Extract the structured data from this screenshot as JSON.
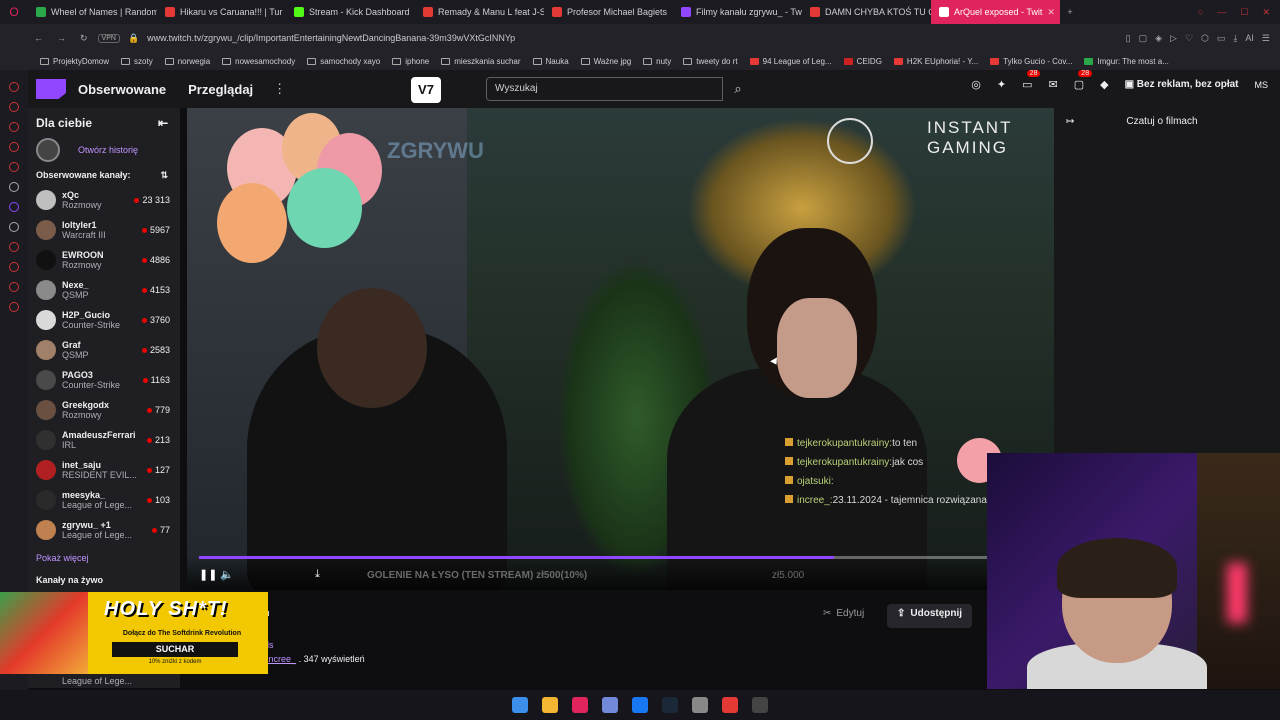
{
  "browser": {
    "tabs": [
      {
        "label": "Wheel of Names | Random",
        "color": "#2aa84a"
      },
      {
        "label": "Hikaru vs Caruana!!! | Tur",
        "color": "#e53935"
      },
      {
        "label": "Stream - Kick Dashboard",
        "color": "#53fc18"
      },
      {
        "label": "Remady & Manu L feat J-S",
        "color": "#e53935"
      },
      {
        "label": "Profesor Michael Bagiets",
        "color": "#e53935"
      },
      {
        "label": "Filmy kanału zgrywu_ - Tw",
        "color": "#9147ff"
      },
      {
        "label": "DAMN CHYBA KTOŚ TU C",
        "color": "#e53935"
      },
      {
        "label": "ArQuel exposed - Twit",
        "color": "#9147ff",
        "active": true
      }
    ],
    "url": "www.twitch.tv/zgrywu_/clip/ImportantEntertainingNewtDancingBanana-39m39wVXtGcINNYp",
    "vpn_label": "VPN",
    "ai_label": "AI",
    "bookmarks": [
      "ProjektyDomow",
      "szoty",
      "norwegia",
      "nowesamochody",
      "samochody xayo",
      "iphone",
      "mieszkania suchar",
      "Nauka",
      "Ważne jpg",
      "nuty",
      "tweety do rt",
      "94 League of Leg...",
      "CEIDG",
      "H2K EUphoria! - Y...",
      "Tylko Gucio - Cov...",
      "Imgur: The most a..."
    ]
  },
  "twitch": {
    "nav_following": "Obserwowane",
    "nav_browse": "Przeglądaj",
    "search_placeholder": "Wyszukaj",
    "badge_count_1": "28",
    "badge_count_2": "28",
    "adfree_label": "Bez reklam, bez opłat",
    "user_initials": "MS",
    "ext_label": "V7"
  },
  "sidebar": {
    "title": "Dla ciebie",
    "history_label": "Otwórz historię",
    "following_label": "Obserwowane kanały:",
    "channels": [
      {
        "name": "xQc",
        "game": "Rozmowy",
        "viewers": "23 313",
        "color": "#bfbfbf"
      },
      {
        "name": "loltyler1",
        "game": "Warcraft III",
        "viewers": "5967",
        "color": "#7a5c4a"
      },
      {
        "name": "EWROON",
        "game": "Rozmowy",
        "viewers": "4886",
        "color": "#111111"
      },
      {
        "name": "Nexe_",
        "game": "QSMP",
        "viewers": "4153",
        "color": "#8a8a8a"
      },
      {
        "name": "H2P_Gucio",
        "game": "Counter-Strike",
        "viewers": "3760",
        "color": "#d9d9d9"
      },
      {
        "name": "Graf",
        "game": "QSMP",
        "viewers": "2583",
        "color": "#a08068"
      },
      {
        "name": "PAGO3",
        "game": "Counter-Strike",
        "viewers": "1163",
        "color": "#4a4a4a"
      },
      {
        "name": "Greekgodx",
        "game": "Rozmowy",
        "viewers": "779",
        "color": "#6a5040"
      },
      {
        "name": "AmadeuszFerrari",
        "game": "IRL",
        "viewers": "213",
        "color": "#303030"
      },
      {
        "name": "inet_saju",
        "game": "RESIDENT EVIL...",
        "viewers": "127",
        "color": "#b02020"
      },
      {
        "name": "meesyka_",
        "game": "League of Lege...",
        "viewers": "103",
        "color": "#2a2a2a"
      },
      {
        "name": "zgrywu_ +1",
        "game": "League of Lege...",
        "viewers": "77",
        "color": "#c08050"
      }
    ],
    "show_more": "Pokaż więcej",
    "live_channels": "Kanały na żywo",
    "bottom_game": "League of Lege..."
  },
  "video": {
    "sponsor": "INSTANT GAMING",
    "watermark": "ZGRYWU",
    "goal_text": "GOLENIE NA ŁYSO (TEN STREAM) zł500(10%)",
    "goal_right": "zł5.000",
    "progress": 0.76,
    "chat_overlay": [
      {
        "user": "tejkerokupantukrainy:",
        "msg": "to ten"
      },
      {
        "user": "tejkerokupantukrainy:",
        "msg": "jak cos"
      },
      {
        "user": "ojatsuki:",
        "msg": ""
      },
      {
        "user": "incree_:",
        "msg": "23.11.2024 - tajemnica rozwiązana"
      }
    ]
  },
  "chat_panel": {
    "title": "Czatuj o filmach"
  },
  "clip_info": {
    "title_fragment": "ku",
    "sub_fragment": "nds",
    "author_prefix": "a",
    "author": "incree_",
    "views": ". 347 wyświetleń",
    "edit_label": "Edytuj",
    "share_label": "Udostępnij"
  },
  "ad": {
    "headline": "HOLY SH*T!",
    "line": "Dołącz do The Softdrink Revolution",
    "button": "SUCHAR",
    "discount": "10% zniżki z kodem"
  },
  "taskbar_colors": [
    "#3b8eea",
    "#f2b632",
    "#e0245e",
    "#7289da",
    "#1877f2",
    "#1b2838",
    "#888888",
    "#e53935",
    "#444444"
  ]
}
